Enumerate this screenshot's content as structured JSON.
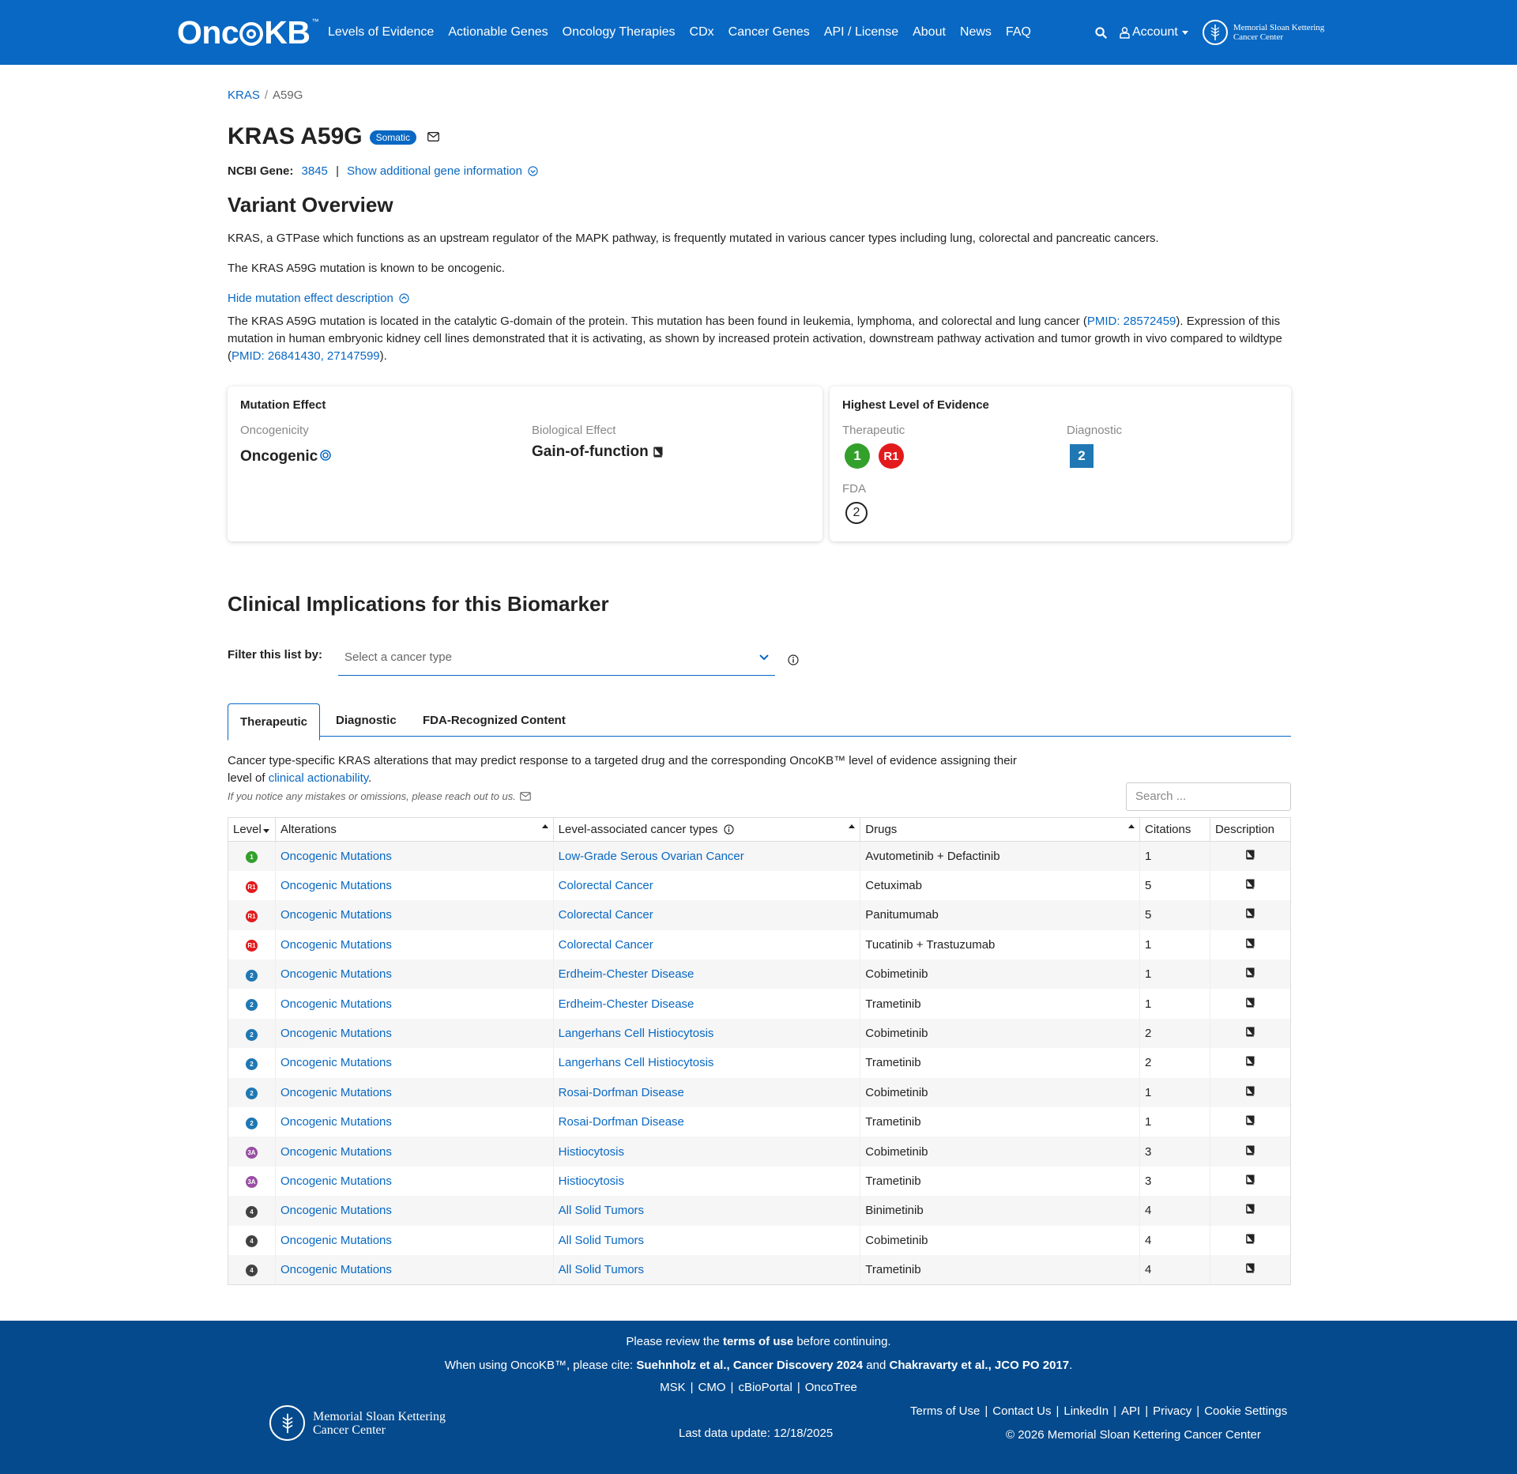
{
  "nav": {
    "logo": "OncoKB",
    "logo_tm": "™",
    "links": [
      "Levels of Evidence",
      "Actionable Genes",
      "Oncology Therapies",
      "CDx",
      "Cancer Genes",
      "API / License",
      "About",
      "News",
      "FAQ"
    ],
    "account": "Account",
    "msk_line1": "Memorial Sloan Kettering",
    "msk_line2": "Cancer Center"
  },
  "breadcrumb": {
    "gene": "KRAS",
    "sep": "/",
    "variant": "A59G"
  },
  "header": {
    "title": "KRAS A59G",
    "badge": "Somatic",
    "ncbi_label": "NCBI Gene:",
    "ncbi_id": "3845",
    "pipe": "|",
    "show_more": "Show additional gene information"
  },
  "overview": {
    "title": "Variant Overview",
    "gene_summary": "KRAS, a GTPase which functions as an upstream regulator of the MAPK pathway, is frequently mutated in various cancer types including lung, colorectal and pancreatic cancers.",
    "variant_summary": "The KRAS A59G mutation is known to be oncogenic.",
    "toggle": "Hide mutation effect description",
    "desc_part1": "The KRAS A59G mutation is located in the catalytic G-domain of the protein. This mutation has been found in leukemia, lymphoma, and colorectal and lung cancer (",
    "desc_pmid1": "PMID: 28572459",
    "desc_part2": "). Expression of this mutation in human embryonic kidney cell lines demonstrated that it is activating, as shown by increased protein activation, downstream pathway activation and tumor growth in vivo compared to wildtype (",
    "desc_pmid2": "PMID: 26841430, 27147599",
    "desc_part3": ")."
  },
  "mutation_effect": {
    "title": "Mutation Effect",
    "oncogenicity_label": "Oncogenicity",
    "oncogenicity_value": "Oncogenic",
    "bio_label": "Biological Effect",
    "bio_value": "Gain-of-function"
  },
  "evidence": {
    "title": "Highest Level of Evidence",
    "therapeutic_label": "Therapeutic",
    "therapeutic_levels": [
      "1",
      "R1"
    ],
    "diagnostic_label": "Diagnostic",
    "diagnostic_level": "2",
    "fda_label": "FDA",
    "fda_level": "2"
  },
  "clinical": {
    "title": "Clinical Implications for this Biomarker",
    "filter_label": "Filter this list by:",
    "filter_placeholder": "Select a cancer type",
    "tabs": [
      "Therapeutic",
      "Diagnostic",
      "FDA-Recognized Content"
    ],
    "intro_part1": "Cancer type-specific KRAS alterations that may predict response to a targeted drug and the corresponding OncoKB™ level of evidence assigning their level of ",
    "intro_link": "clinical actionability",
    "intro_part2": ".",
    "note": "If you notice any mistakes or omissions, please reach out to us.",
    "search_placeholder": "Search ...",
    "columns": [
      "Level",
      "Alterations",
      "Level-associated cancer types",
      "Drugs",
      "Citations",
      "Description"
    ],
    "rows": [
      {
        "level": "1",
        "alteration": "Oncogenic Mutations",
        "cancer": "Low-Grade Serous Ovarian Cancer",
        "drugs": "Avutometinib + Defactinib",
        "citations": "1"
      },
      {
        "level": "R1",
        "alteration": "Oncogenic Mutations",
        "cancer": "Colorectal Cancer",
        "drugs": "Cetuximab",
        "citations": "5"
      },
      {
        "level": "R1",
        "alteration": "Oncogenic Mutations",
        "cancer": "Colorectal Cancer",
        "drugs": "Panitumumab",
        "citations": "5"
      },
      {
        "level": "R1",
        "alteration": "Oncogenic Mutations",
        "cancer": "Colorectal Cancer",
        "drugs": "Tucatinib + Trastuzumab",
        "citations": "1"
      },
      {
        "level": "2",
        "alteration": "Oncogenic Mutations",
        "cancer": "Erdheim-Chester Disease",
        "drugs": "Cobimetinib",
        "citations": "1"
      },
      {
        "level": "2",
        "alteration": "Oncogenic Mutations",
        "cancer": "Erdheim-Chester Disease",
        "drugs": "Trametinib",
        "citations": "1"
      },
      {
        "level": "2",
        "alteration": "Oncogenic Mutations",
        "cancer": "Langerhans Cell Histiocytosis",
        "drugs": "Cobimetinib",
        "citations": "2"
      },
      {
        "level": "2",
        "alteration": "Oncogenic Mutations",
        "cancer": "Langerhans Cell Histiocytosis",
        "drugs": "Trametinib",
        "citations": "2"
      },
      {
        "level": "2",
        "alteration": "Oncogenic Mutations",
        "cancer": "Rosai-Dorfman Disease",
        "drugs": "Cobimetinib",
        "citations": "1"
      },
      {
        "level": "2",
        "alteration": "Oncogenic Mutations",
        "cancer": "Rosai-Dorfman Disease",
        "drugs": "Trametinib",
        "citations": "1"
      },
      {
        "level": "3A",
        "alteration": "Oncogenic Mutations",
        "cancer": "Histiocytosis",
        "drugs": "Cobimetinib",
        "citations": "3"
      },
      {
        "level": "3A",
        "alteration": "Oncogenic Mutations",
        "cancer": "Histiocytosis",
        "drugs": "Trametinib",
        "citations": "3"
      },
      {
        "level": "4",
        "alteration": "Oncogenic Mutations",
        "cancer": "All Solid Tumors",
        "drugs": "Binimetinib",
        "citations": "4"
      },
      {
        "level": "4",
        "alteration": "Oncogenic Mutations",
        "cancer": "All Solid Tumors",
        "drugs": "Cobimetinib",
        "citations": "4"
      },
      {
        "level": "4",
        "alteration": "Oncogenic Mutations",
        "cancer": "All Solid Tumors",
        "drugs": "Trametinib",
        "citations": "4"
      }
    ]
  },
  "footer": {
    "review_part1": "Please review the ",
    "review_link": "terms of use",
    "review_part2": " before continuing.",
    "cite_part1": "When using OncoKB™, please cite: ",
    "cite_ref1": "Suehnholz et al., Cancer Discovery 2024",
    "cite_and": " and ",
    "cite_ref2": "Chakravarty et al., JCO PO 2017",
    "cite_end": ".",
    "links": [
      "MSK",
      "CMO",
      "cBioPortal",
      "OncoTree"
    ],
    "msk_line1": "Memorial Sloan Kettering",
    "msk_line2": "Cancer Center",
    "last_update": "Last data update: 12/18/2025",
    "right_links": [
      "Terms of Use",
      "Contact Us",
      "LinkedIn",
      "API",
      "Privacy",
      "Cookie Settings"
    ],
    "copyright": "© 2026 Memorial Sloan Kettering Cancer Center"
  },
  "colors": {
    "brand": "#0968c3",
    "footer": "#054a8c",
    "level_1": "#33a02c",
    "level_r1": "#e31a1c",
    "level_2": "#1f78b4",
    "level_3a": "#984ea3",
    "level_4": "#424242"
  }
}
